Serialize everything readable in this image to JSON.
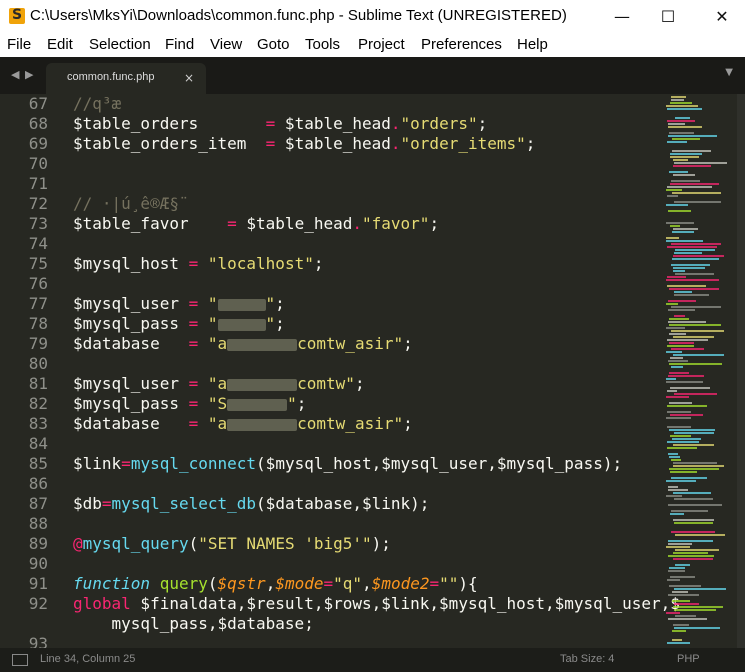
{
  "window": {
    "title": "C:\\Users\\MksYi\\Downloads\\common.func.php - Sublime Text (UNREGISTERED)",
    "app_icon": "sublime-text-icon",
    "controls": {
      "minimize": "—",
      "maximize": "☐",
      "close": "✕"
    }
  },
  "menu": [
    {
      "label": "File"
    },
    {
      "label": "Edit"
    },
    {
      "label": "Selection"
    },
    {
      "label": "Find"
    },
    {
      "label": "View"
    },
    {
      "label": "Goto"
    },
    {
      "label": "Tools"
    },
    {
      "label": "Project"
    },
    {
      "label": "Preferences"
    },
    {
      "label": "Help"
    }
  ],
  "tabs": {
    "nav_back": "◀",
    "nav_forward": "▶",
    "items": [
      {
        "label": "common.func.php",
        "close": "×"
      }
    ],
    "dropdown": "▼"
  },
  "editor": {
    "lines": [
      {
        "n": "67",
        "parts": [
          {
            "t": "c",
            "v": "//q³æ"
          }
        ]
      },
      {
        "n": "68",
        "parts": [
          {
            "t": "",
            "v": "$table_orders       "
          },
          {
            "t": "o",
            "v": "="
          },
          {
            "t": "",
            "v": " $table_head"
          },
          {
            "t": "o",
            "v": "."
          },
          {
            "t": "s",
            "v": "\"orders\""
          },
          {
            "t": "",
            "v": ";"
          }
        ]
      },
      {
        "n": "69",
        "parts": [
          {
            "t": "",
            "v": "$table_orders_item  "
          },
          {
            "t": "o",
            "v": "="
          },
          {
            "t": "",
            "v": " $table_head"
          },
          {
            "t": "o",
            "v": "."
          },
          {
            "t": "s",
            "v": "\"order_items\""
          },
          {
            "t": "",
            "v": ";"
          }
        ]
      },
      {
        "n": "70",
        "parts": []
      },
      {
        "n": "71",
        "parts": []
      },
      {
        "n": "72",
        "parts": [
          {
            "t": "c",
            "v": "// ·|ú¸ê®Æ§¨"
          }
        ]
      },
      {
        "n": "73",
        "parts": [
          {
            "t": "",
            "v": "$table_favor    "
          },
          {
            "t": "o",
            "v": "="
          },
          {
            "t": "",
            "v": " $table_head"
          },
          {
            "t": "o",
            "v": "."
          },
          {
            "t": "s",
            "v": "\"favor\""
          },
          {
            "t": "",
            "v": ";"
          }
        ]
      },
      {
        "n": "74",
        "parts": []
      },
      {
        "n": "75",
        "parts": [
          {
            "t": "",
            "v": "$mysql_host "
          },
          {
            "t": "o",
            "v": "="
          },
          {
            "t": "",
            "v": " "
          },
          {
            "t": "s",
            "v": "\"localhost\""
          },
          {
            "t": "",
            "v": ";"
          }
        ]
      },
      {
        "n": "76",
        "parts": []
      },
      {
        "n": "77",
        "parts": [
          {
            "t": "",
            "v": "$mysql_user "
          },
          {
            "t": "o",
            "v": "="
          },
          {
            "t": "",
            "v": " "
          },
          {
            "t": "s",
            "v": "\""
          },
          {
            "t": "blur",
            "v": "48"
          },
          {
            "t": "s",
            "v": "\""
          },
          {
            "t": "",
            "v": ";"
          }
        ]
      },
      {
        "n": "78",
        "parts": [
          {
            "t": "",
            "v": "$mysql_pass "
          },
          {
            "t": "o",
            "v": "="
          },
          {
            "t": "",
            "v": " "
          },
          {
            "t": "s",
            "v": "\""
          },
          {
            "t": "blur",
            "v": "48"
          },
          {
            "t": "s",
            "v": "\""
          },
          {
            "t": "",
            "v": ";"
          }
        ]
      },
      {
        "n": "79",
        "parts": [
          {
            "t": "",
            "v": "$database   "
          },
          {
            "t": "o",
            "v": "="
          },
          {
            "t": "",
            "v": " "
          },
          {
            "t": "s",
            "v": "\"a"
          },
          {
            "t": "blur",
            "v": "70"
          },
          {
            "t": "s",
            "v": "comtw_asir\""
          },
          {
            "t": "",
            "v": ";"
          }
        ]
      },
      {
        "n": "80",
        "parts": []
      },
      {
        "n": "81",
        "parts": [
          {
            "t": "",
            "v": "$mysql_user "
          },
          {
            "t": "o",
            "v": "="
          },
          {
            "t": "",
            "v": " "
          },
          {
            "t": "s",
            "v": "\"a"
          },
          {
            "t": "blur",
            "v": "70"
          },
          {
            "t": "s",
            "v": "comtw\""
          },
          {
            "t": "",
            "v": ";"
          }
        ]
      },
      {
        "n": "82",
        "parts": [
          {
            "t": "",
            "v": "$mysql_pass "
          },
          {
            "t": "o",
            "v": "="
          },
          {
            "t": "",
            "v": " "
          },
          {
            "t": "s",
            "v": "\"S"
          },
          {
            "t": "blur",
            "v": "60"
          },
          {
            "t": "s",
            "v": "\""
          },
          {
            "t": "",
            "v": ";"
          }
        ]
      },
      {
        "n": "83",
        "parts": [
          {
            "t": "",
            "v": "$database   "
          },
          {
            "t": "o",
            "v": "="
          },
          {
            "t": "",
            "v": " "
          },
          {
            "t": "s",
            "v": "\"a"
          },
          {
            "t": "blur",
            "v": "70"
          },
          {
            "t": "s",
            "v": "comtw_asir\""
          },
          {
            "t": "",
            "v": ";"
          }
        ]
      },
      {
        "n": "84",
        "parts": []
      },
      {
        "n": "85",
        "parts": [
          {
            "t": "",
            "v": "$link"
          },
          {
            "t": "o",
            "v": "="
          },
          {
            "t": "f",
            "v": "mysql_connect"
          },
          {
            "t": "",
            "v": "($mysql_host,$mysql_user,$mysql_pass);"
          }
        ]
      },
      {
        "n": "86",
        "parts": []
      },
      {
        "n": "87",
        "parts": [
          {
            "t": "",
            "v": "$db"
          },
          {
            "t": "o",
            "v": "="
          },
          {
            "t": "f",
            "v": "mysql_select_db"
          },
          {
            "t": "",
            "v": "($database,$link);"
          }
        ]
      },
      {
        "n": "88",
        "parts": []
      },
      {
        "n": "89",
        "parts": [
          {
            "t": "o",
            "v": "@"
          },
          {
            "t": "f",
            "v": "mysql_query"
          },
          {
            "t": "",
            "v": "("
          },
          {
            "t": "s",
            "v": "\"SET NAMES 'big5'\""
          },
          {
            "t": "",
            "v": ");"
          }
        ]
      },
      {
        "n": "90",
        "parts": []
      },
      {
        "n": "91",
        "parts": [
          {
            "t": "k",
            "v": "function"
          },
          {
            "t": "",
            "v": " "
          },
          {
            "t": "fn",
            "v": "query"
          },
          {
            "t": "",
            "v": "("
          },
          {
            "t": "p",
            "v": "$qstr"
          },
          {
            "t": "",
            "v": ","
          },
          {
            "t": "p",
            "v": "$mode"
          },
          {
            "t": "o",
            "v": "="
          },
          {
            "t": "s",
            "v": "\"q\""
          },
          {
            "t": "",
            "v": ","
          },
          {
            "t": "p",
            "v": "$mode2"
          },
          {
            "t": "o",
            "v": "="
          },
          {
            "t": "s",
            "v": "\"\""
          },
          {
            "t": "",
            "v": "){"
          }
        ]
      },
      {
        "n": "92",
        "parts": [
          {
            "t": "o",
            "v": "global"
          },
          {
            "t": "",
            "v": " $finaldata,$result,$rows,$link,$mysql_host,$mysql_user,$"
          }
        ]
      },
      {
        "n": "",
        "parts": [
          {
            "t": "",
            "v": "    mysql_pass,$database;"
          }
        ]
      },
      {
        "n": "93",
        "parts": []
      }
    ]
  },
  "status": {
    "position": "Line 34, Column 25",
    "tab_size": "Tab Size: 4",
    "syntax": "PHP"
  },
  "colors": {
    "background": "#272822",
    "comment": "#75715e",
    "operator": "#f92672",
    "string": "#e6db74",
    "builtin": "#66d9ef",
    "function_name": "#a6e22e",
    "parameter": "#fd971f"
  }
}
